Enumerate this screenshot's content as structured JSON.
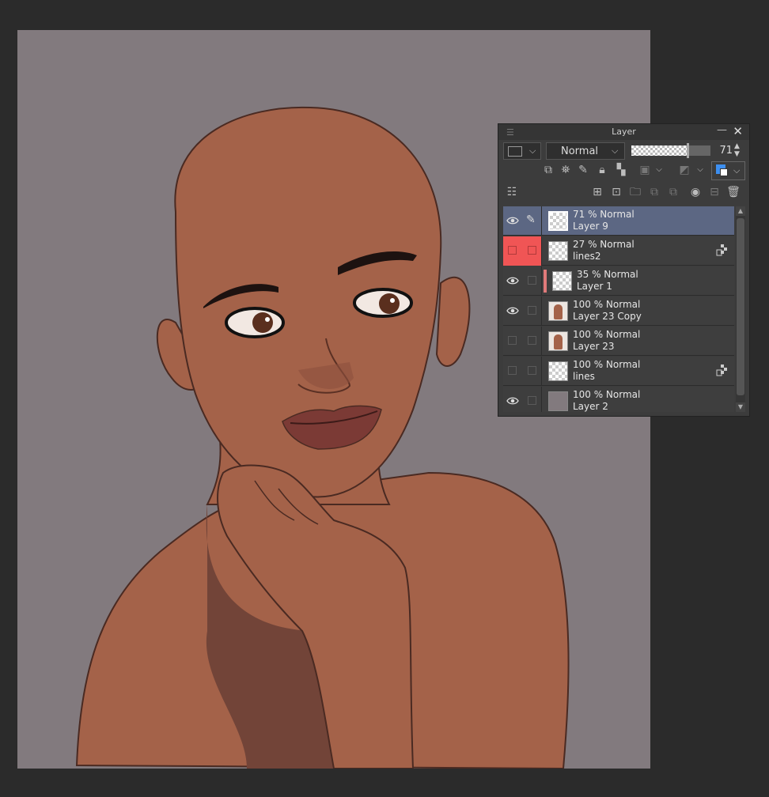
{
  "panel": {
    "title": "Layer",
    "blend_mode": "Normal",
    "opacity_value": "71",
    "opacity_fraction": 0.71
  },
  "layers": [
    {
      "opacity_mode": "71 % Normal",
      "name": "Layer 9",
      "visible": true,
      "selected": true,
      "editing": true
    },
    {
      "opacity_mode": "27 % Normal",
      "name": "lines2",
      "visible": false,
      "highlighted": true,
      "reference_icon": "checker-lock-icon"
    },
    {
      "opacity_mode": "35 % Normal",
      "name": "Layer 1",
      "visible": true,
      "clipped": true
    },
    {
      "opacity_mode": "100 % Normal",
      "name": "Layer 23 Copy",
      "visible": true
    },
    {
      "opacity_mode": "100 % Normal",
      "name": "Layer 23",
      "visible": false
    },
    {
      "opacity_mode": "100 % Normal",
      "name": "lines",
      "visible": false,
      "reference_icon": "checker-lock-icon"
    },
    {
      "opacity_mode": "100 % Normal",
      "name": "Layer 2",
      "visible": true
    }
  ],
  "colors": {
    "canvas_bg": "#827a7e",
    "skin": "#a46249",
    "shadow": "#724438",
    "selected_layer": "#5c6783",
    "highlight_red": "#f05555"
  }
}
